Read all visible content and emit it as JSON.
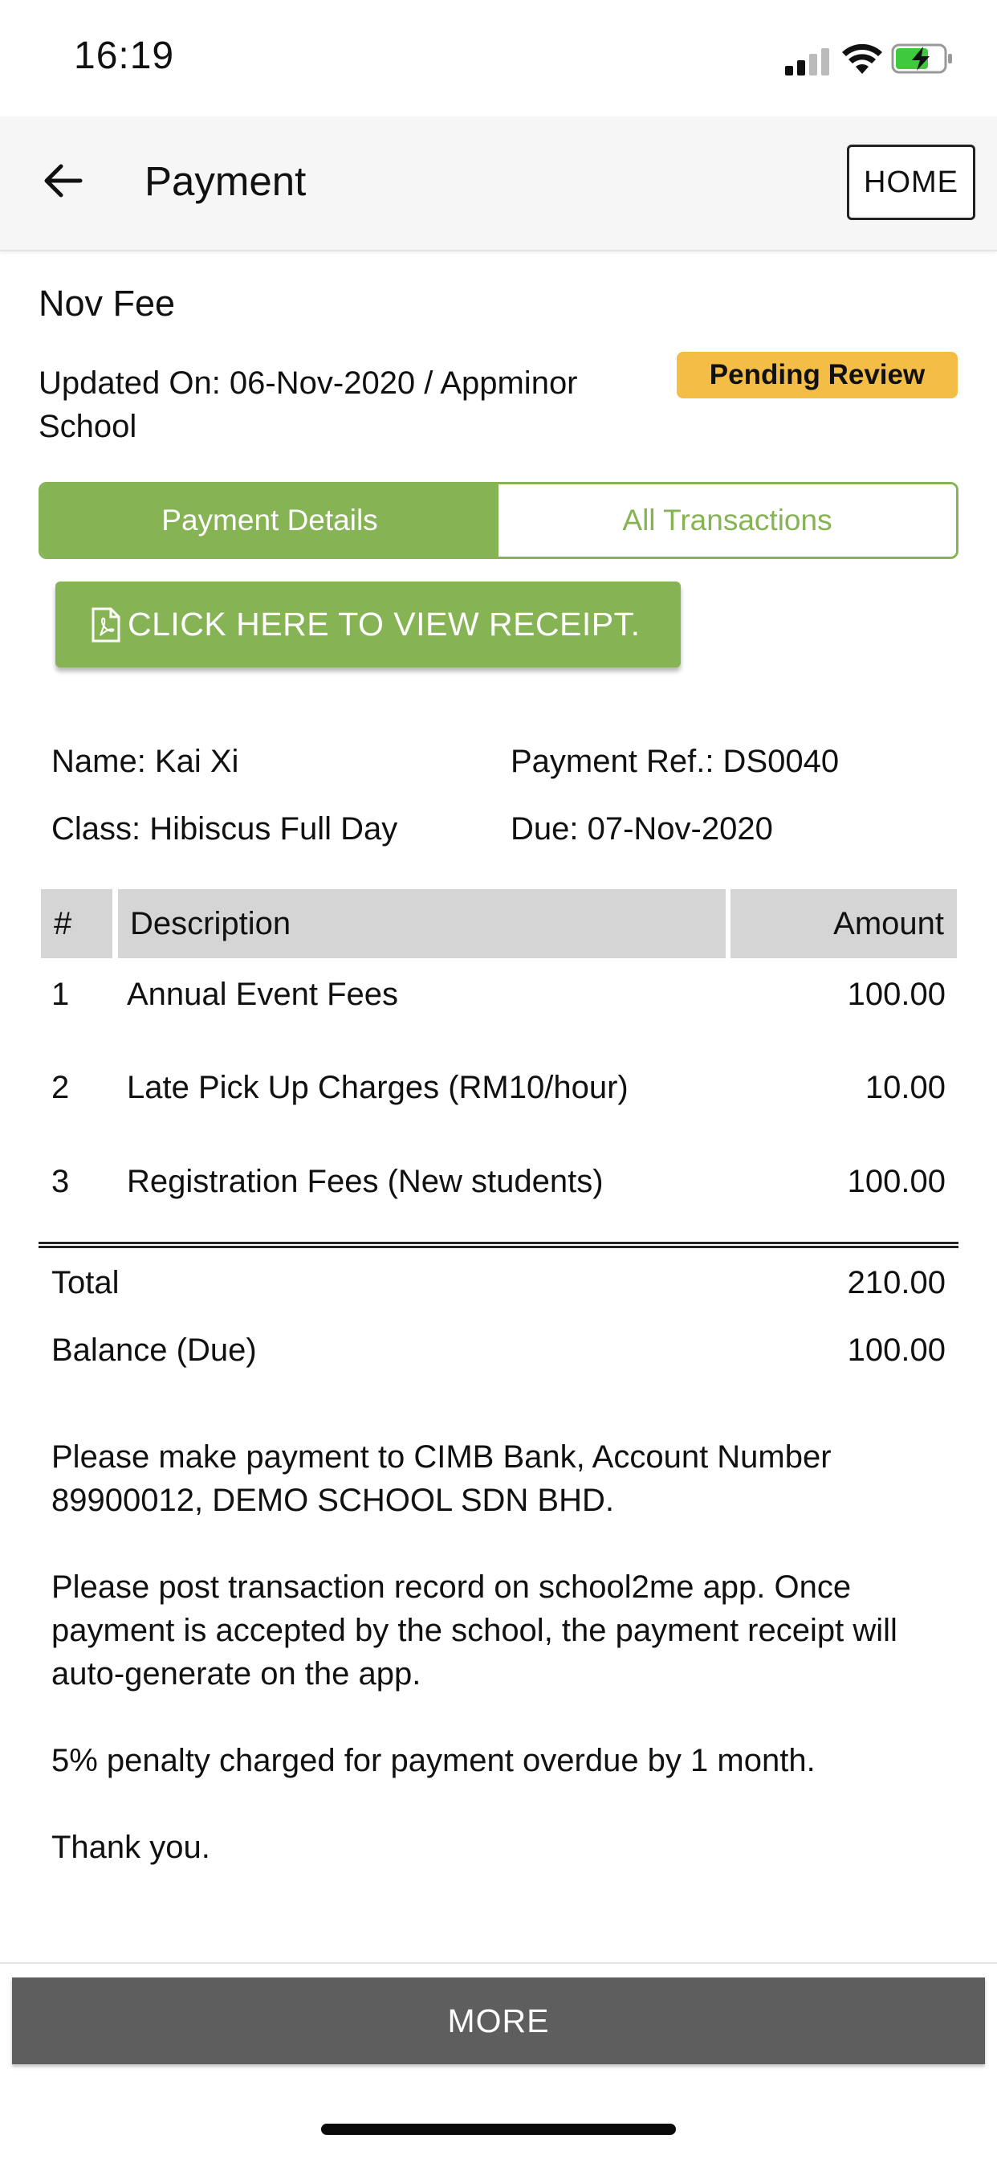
{
  "status_bar": {
    "time": "16:19"
  },
  "header": {
    "title": "Payment",
    "home_label": "HOME"
  },
  "fee": {
    "title": "Nov Fee",
    "updated": "Updated On: 06-Nov-2020 / Appminor School",
    "status_badge": "Pending Review"
  },
  "tabs": [
    {
      "label": "Payment Details",
      "active": true
    },
    {
      "label": "All Transactions",
      "active": false
    }
  ],
  "receipt_button": "CLICK HERE TO VIEW RECEIPT.",
  "info": {
    "name": "Name: Kai Xi",
    "payment_ref": "Payment Ref.: DS0040",
    "class": "Class: Hibiscus Full Day",
    "due": "Due: 07-Nov-2020"
  },
  "table": {
    "headers": {
      "num": "#",
      "description": "Description",
      "amount": "Amount"
    },
    "rows": [
      {
        "num": "1",
        "description": "Annual Event Fees",
        "amount": "100.00"
      },
      {
        "num": "2",
        "description": "Late Pick Up Charges (RM10/hour)",
        "amount": "10.00"
      },
      {
        "num": "3",
        "description": "Registration Fees (New students)",
        "amount": "100.00"
      }
    ]
  },
  "totals": {
    "total_label": "Total",
    "total_value": "210.00",
    "balance_label": "Balance (Due)",
    "balance_value": "100.00"
  },
  "notes": [
    "Please make payment to CIMB Bank, Account Number 89900012, DEMO SCHOOL SDN BHD.",
    "Please post transaction record on school2me app. Once payment is accepted by the school, the payment receipt will auto-generate on the app.",
    "5% penalty charged for payment overdue by 1 month.",
    "Thank you."
  ],
  "more_label": "MORE",
  "colors": {
    "accent_green": "#86b455",
    "badge_yellow": "#f4bd45",
    "more_button": "#5e5e5e",
    "table_header": "#d5d5d5"
  }
}
